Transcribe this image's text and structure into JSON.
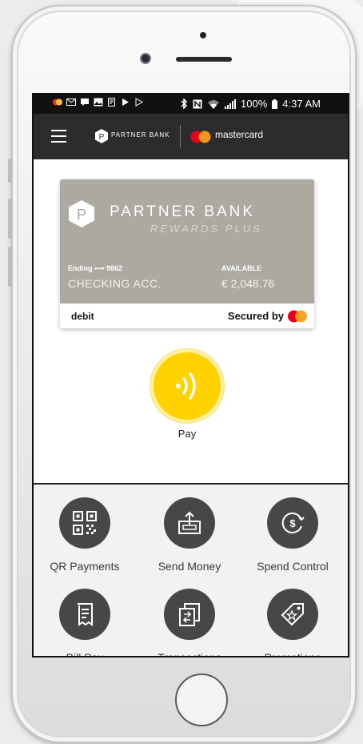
{
  "status_bar": {
    "battery": "100%",
    "time": "4:37 AM"
  },
  "app_bar": {
    "brand": "PARTNER BANK",
    "network": "mastercard"
  },
  "card": {
    "logo_letter": "P",
    "bank_name": "PARTNER BANK",
    "program": "REWARDS PLUS",
    "ending": "Ending •••• 9862",
    "account_type": "CHECKING ACC.",
    "available_label": "AVAILABLE",
    "available_value": "€ 2,048.76",
    "card_type": "debit",
    "secured_by": "Secured by"
  },
  "pay": {
    "label": "Pay"
  },
  "actions": [
    {
      "label": "QR Payments",
      "icon": "qr-code-icon"
    },
    {
      "label": "Send Money",
      "icon": "send-money-icon"
    },
    {
      "label": "Spend Control",
      "icon": "spend-control-icon"
    },
    {
      "label": "Bill Pay",
      "icon": "bill-icon"
    },
    {
      "label": "Transactions",
      "icon": "transactions-icon"
    },
    {
      "label": "Promotions",
      "icon": "promotions-icon"
    }
  ],
  "colors": {
    "app_bar": "#2c2c2c",
    "card": "#aca9a1",
    "pay_button": "#ffd200",
    "action_icon_bg": "#474747",
    "mastercard_red": "#eb001b",
    "mastercard_orange": "#f79e1b"
  }
}
